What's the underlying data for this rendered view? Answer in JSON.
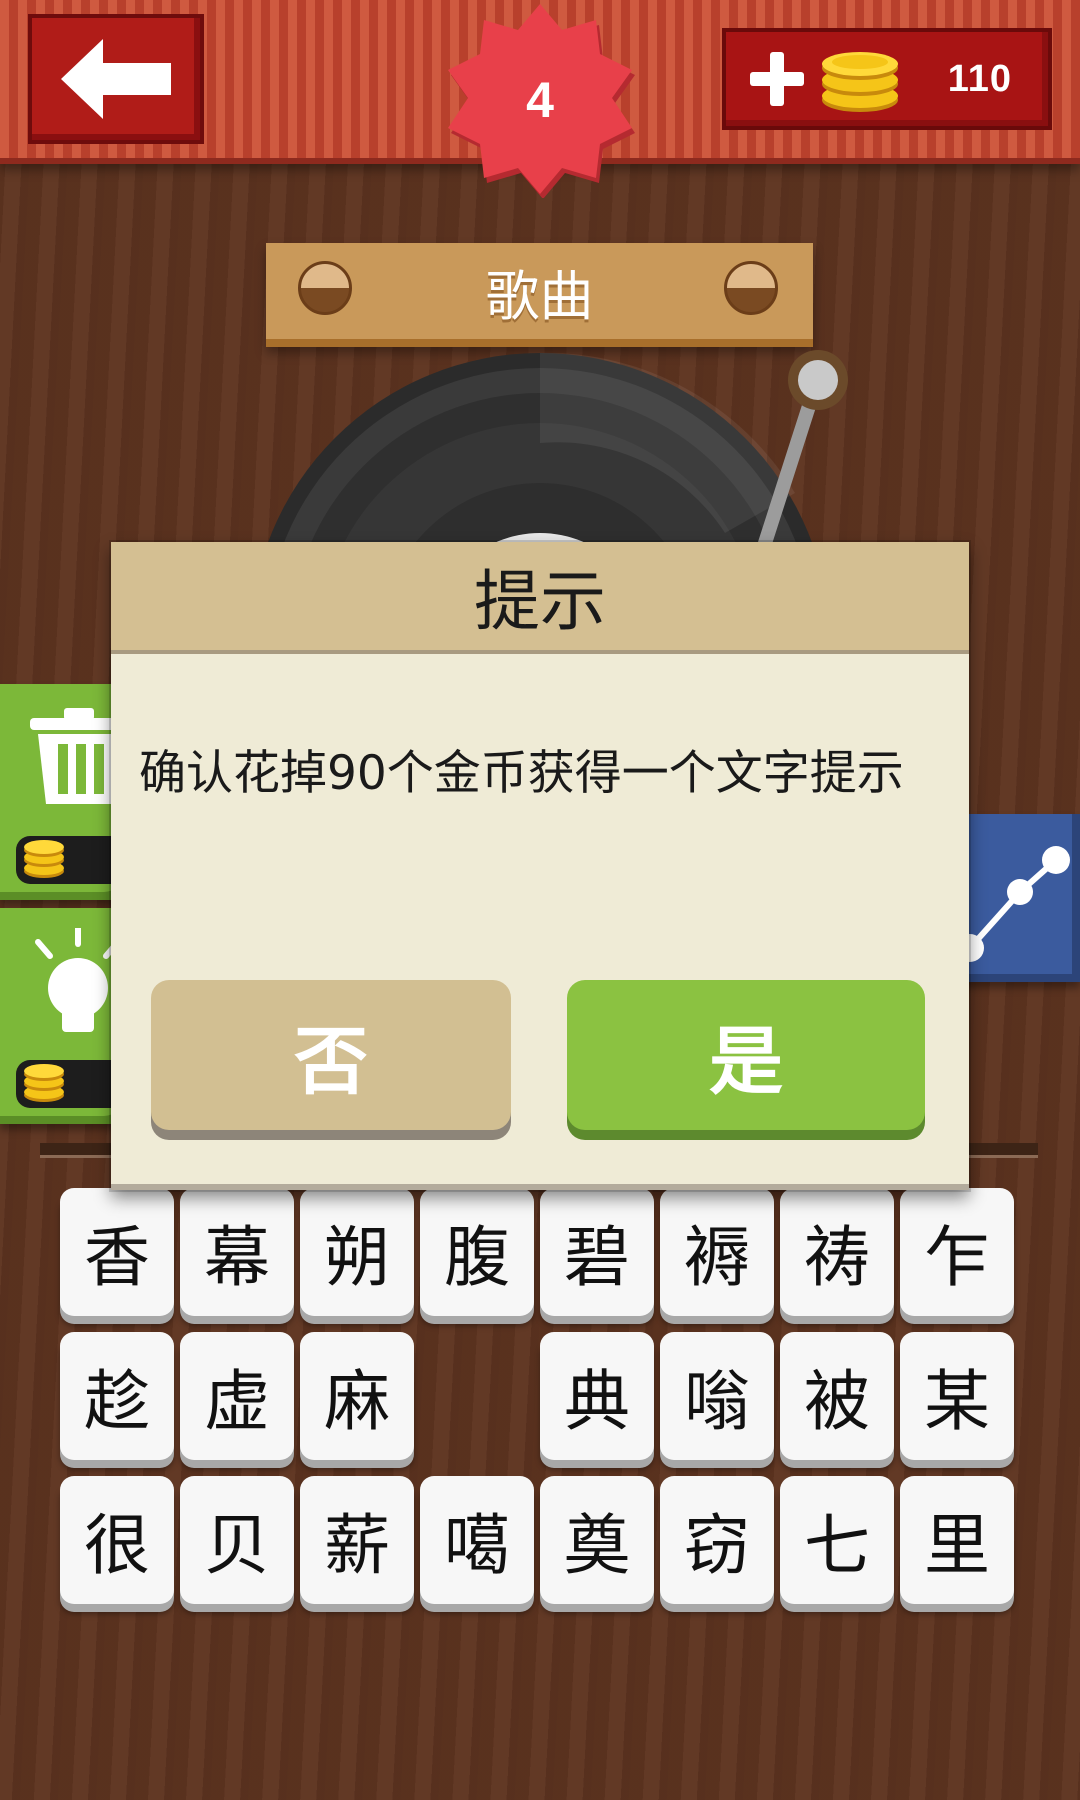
{
  "header": {
    "level": "4",
    "coins": "110"
  },
  "category": "歌曲",
  "dialog": {
    "title": "提示",
    "message": "确认花掉90个金币获得一个文字提示",
    "no_label": "否",
    "yes_label": "是"
  },
  "keyboard": {
    "rows": [
      [
        "香",
        "幕",
        "朔",
        "腹",
        "碧",
        "褥",
        "祷",
        "乍"
      ],
      [
        "趁",
        "虚",
        "麻",
        "",
        "典",
        "嗡",
        "被",
        "某"
      ],
      [
        "很",
        "贝",
        "薪",
        "噶",
        "奠",
        "窃",
        "七",
        "里"
      ]
    ]
  },
  "icons": {
    "back": "back-arrow-icon",
    "add_coins": "plus-icon",
    "coins": "coin-stack-icon",
    "remove_tool": "trash-icon",
    "hint_tool": "lightbulb-icon",
    "share": "share-icon"
  },
  "colors": {
    "topbar": "#c54a34",
    "button_red": "#b01c18",
    "level_badge": "#e8404a",
    "dialog_bg": "#efebd6",
    "dialog_header": "#d4bf92",
    "yes_green": "#8bc241",
    "no_tan": "#d2bf92"
  }
}
